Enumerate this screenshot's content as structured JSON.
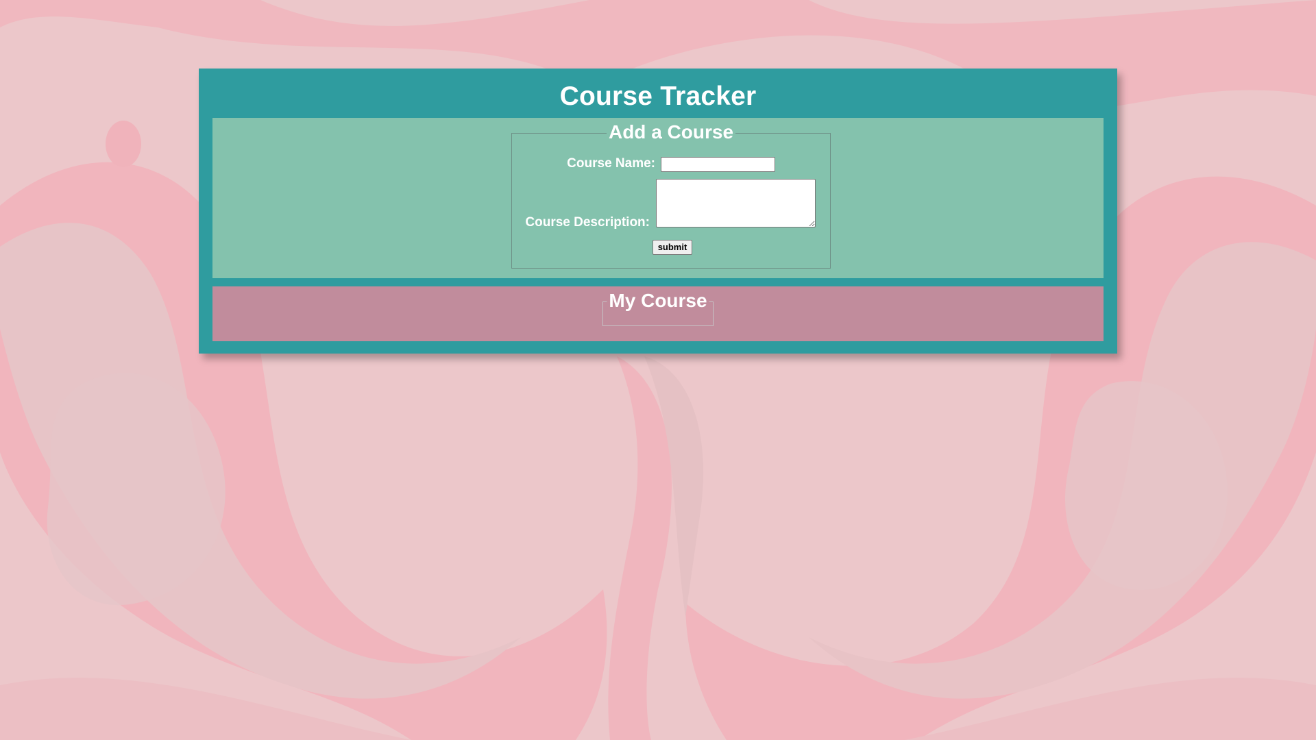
{
  "app": {
    "title": "Course Tracker"
  },
  "add_course": {
    "legend": "Add a Course",
    "name_label": "Course Name:",
    "name_value": "",
    "description_label": "Course Description:",
    "description_value": "",
    "submit_label": "submit"
  },
  "my_course": {
    "legend": "My Course",
    "items": []
  },
  "colors": {
    "header_teal": "#2f9c9f",
    "form_panel_green": "#84c2ad",
    "list_panel_mauve": "#c18c9c",
    "background_pink": "#ecc6c9",
    "text_white": "#ffffff"
  }
}
